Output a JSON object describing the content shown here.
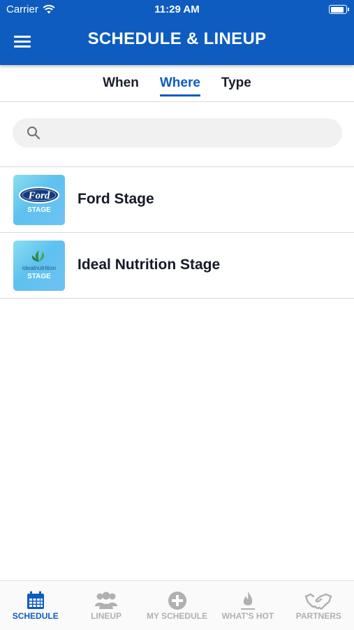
{
  "status_bar": {
    "carrier": "Carrier",
    "time": "11:29 AM",
    "battery_level": 1.0
  },
  "header": {
    "title": "SCHEDULE & LINEUP",
    "menu_icon": "hamburger-menu-icon"
  },
  "tabs": [
    {
      "label": "When",
      "active": false
    },
    {
      "label": "Where",
      "active": true
    },
    {
      "label": "Type",
      "active": false
    }
  ],
  "search": {
    "placeholder": "",
    "value": "",
    "icon": "search-icon"
  },
  "stages": [
    {
      "name": "Ford Stage",
      "logo_text": "Ford",
      "badge": "STAGE"
    },
    {
      "name": "Ideal Nutrition Stage",
      "logo_text": "idealnutrition",
      "badge": "STAGE"
    }
  ],
  "bottom_nav": [
    {
      "label": "SCHEDULE",
      "icon": "calendar-icon",
      "active": true
    },
    {
      "label": "LINEUP",
      "icon": "people-icon",
      "active": false
    },
    {
      "label": "MY SCHEDULE",
      "icon": "plus-circle-icon",
      "active": false
    },
    {
      "label": "WHAT'S HOT",
      "icon": "flame-icon",
      "active": false
    },
    {
      "label": "PARTNERS",
      "icon": "handshake-icon",
      "active": false
    }
  ],
  "colors": {
    "primary": "#0e5cbf",
    "inactive": "#b0b0b0",
    "text": "#151a27"
  }
}
